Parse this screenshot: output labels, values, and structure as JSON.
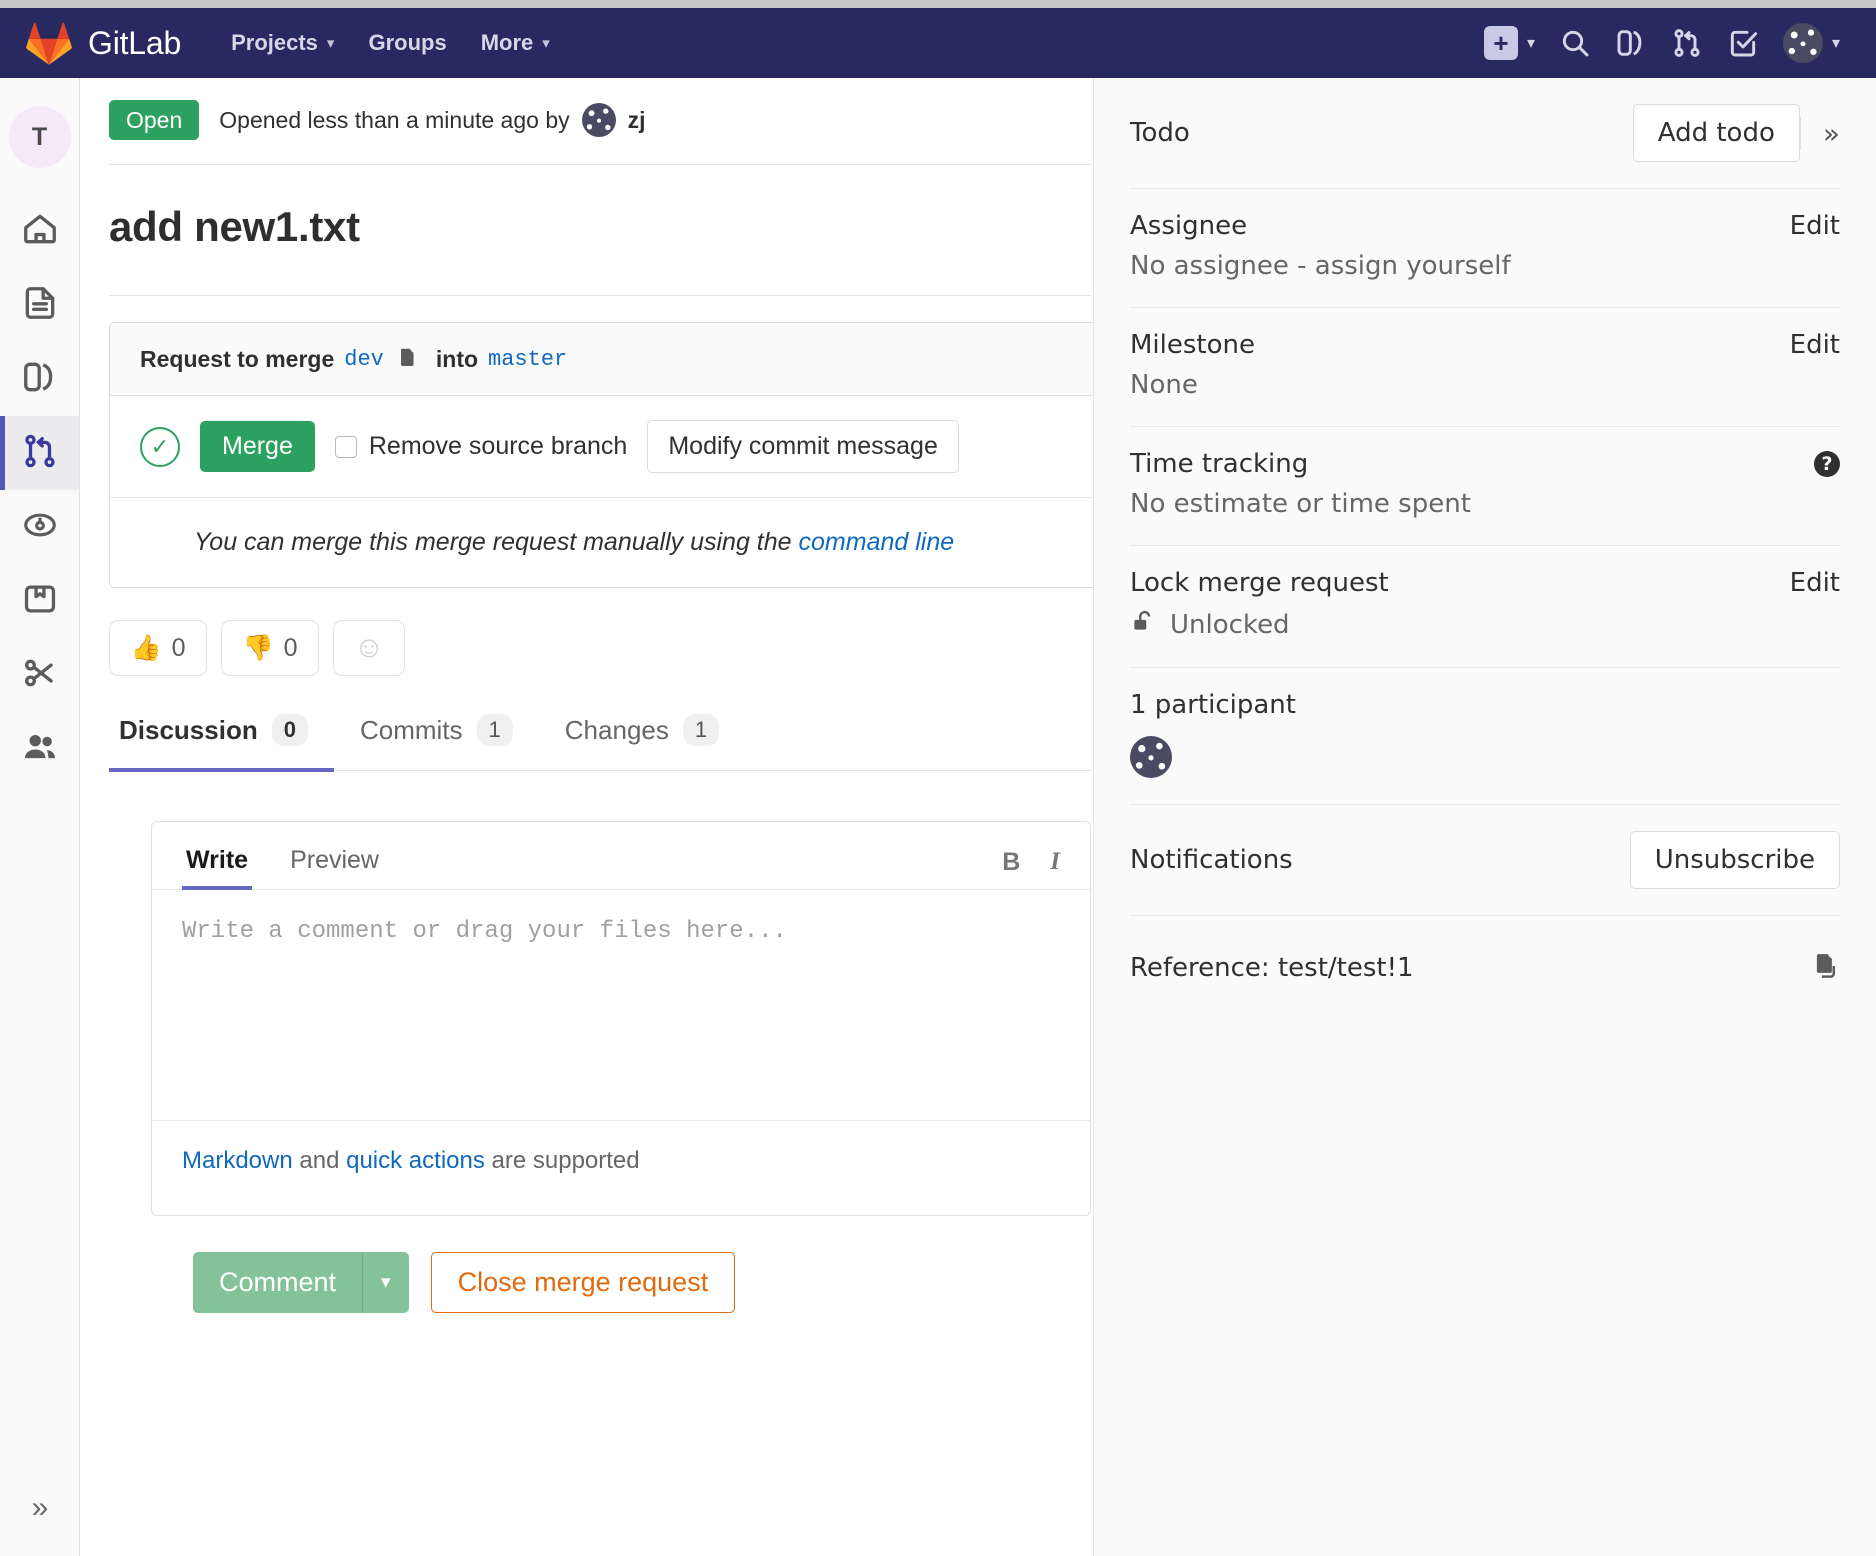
{
  "navbar": {
    "brand": "GitLab",
    "logo_icon": "gitlab-tanuki-logo",
    "items": [
      {
        "label": "Projects",
        "caret": "⌄",
        "icon": "chevron-down-icon"
      },
      {
        "label": "Groups",
        "caret": "",
        "icon": ""
      },
      {
        "label": "More",
        "caret": "⌄",
        "icon": "chevron-down-icon"
      }
    ],
    "right_icons": [
      {
        "name": "plus-new-icon",
        "glyph": "+"
      },
      {
        "name": "chevron-down-icon",
        "glyph": "⌄"
      },
      {
        "name": "search-icon",
        "glyph": ""
      },
      {
        "name": "issues-icon",
        "glyph": ""
      },
      {
        "name": "merge-requests-icon",
        "glyph": ""
      },
      {
        "name": "todos-icon",
        "glyph": ""
      },
      {
        "name": "user-avatar",
        "glyph": ""
      }
    ]
  },
  "rail": {
    "project_initial": "T",
    "items": [
      {
        "name": "home-icon",
        "label": "Project overview"
      },
      {
        "name": "repository-file-icon",
        "label": "Repository"
      },
      {
        "name": "issues-book-icon",
        "label": "Issues"
      },
      {
        "name": "merge-requests-icon",
        "label": "Merge Requests",
        "active": true
      },
      {
        "name": "pipelines-gauge-icon",
        "label": "CI / CD"
      },
      {
        "name": "packages-box-icon",
        "label": "Packages"
      },
      {
        "name": "snippets-scissors-icon",
        "label": "Snippets"
      },
      {
        "name": "members-people-icon",
        "label": "Members"
      }
    ],
    "collapse_label": "»"
  },
  "mr": {
    "status_badge": "Open",
    "opened_text": "Opened less than a minute ago by",
    "author": "zj",
    "title": "add new1.txt",
    "widget": {
      "request_prefix": "Request to merge",
      "source_branch": "dev",
      "copy_icon": "copy-branch-icon",
      "into": "into",
      "target_branch": "master",
      "status_icon": "check-circle-icon",
      "merge_button": "Merge",
      "remove_source_branch_label": "Remove source branch",
      "remove_source_branch_checked": false,
      "modify_commit_message": "Modify commit message",
      "manual_text_prefix": "You can merge this merge request manually using the",
      "manual_link": "command line"
    },
    "reactions": [
      {
        "name": "thumbs-up-reaction",
        "emoji": "👍",
        "count": "0"
      },
      {
        "name": "thumbs-down-reaction",
        "emoji": "👎",
        "count": "0"
      },
      {
        "name": "add-reaction",
        "emoji": "☺",
        "count": ""
      }
    ],
    "tabs": [
      {
        "label": "Discussion",
        "count": "0",
        "active": true
      },
      {
        "label": "Commits",
        "count": "1",
        "active": false
      },
      {
        "label": "Changes",
        "count": "1",
        "active": false
      }
    ]
  },
  "comment_form": {
    "tabs": [
      {
        "label": "Write",
        "active": true
      },
      {
        "label": "Preview",
        "active": false
      }
    ],
    "tools": [
      {
        "name": "bold-icon",
        "glyph": "B"
      },
      {
        "name": "italic-icon",
        "glyph": "I"
      }
    ],
    "placeholder": "Write a comment or drag your files here...",
    "value": "",
    "footer_markdown": "Markdown",
    "footer_and": " and ",
    "footer_quick_actions": "quick actions",
    "footer_suffix": " are supported",
    "comment_button": "Comment",
    "comment_caret": "▾",
    "close_button": "Close merge request"
  },
  "sidebar": {
    "todo": {
      "label": "Todo",
      "button": "Add todo",
      "expand_icon": "»"
    },
    "assignee": {
      "label": "Assignee",
      "edit": "Edit",
      "value": "No assignee - assign yourself"
    },
    "milestone": {
      "label": "Milestone",
      "edit": "Edit",
      "value": "None"
    },
    "time_tracking": {
      "label": "Time tracking",
      "help_icon": "?",
      "value": "No estimate or time spent"
    },
    "lock": {
      "label": "Lock merge request",
      "edit": "Edit",
      "value": "Unlocked",
      "icon": "unlock-icon"
    },
    "participants": {
      "label": "1 participant",
      "avatar": "user-avatar"
    },
    "notifications": {
      "label": "Notifications",
      "button": "Unsubscribe"
    },
    "reference": {
      "label": "Reference: test/test!1",
      "copy_icon": "copy-reference-icon"
    }
  },
  "colors": {
    "navbar": "#292961",
    "green": "#2da160",
    "link": "#1068bf",
    "orange": "#e2690e",
    "accent": "#6666c4"
  }
}
